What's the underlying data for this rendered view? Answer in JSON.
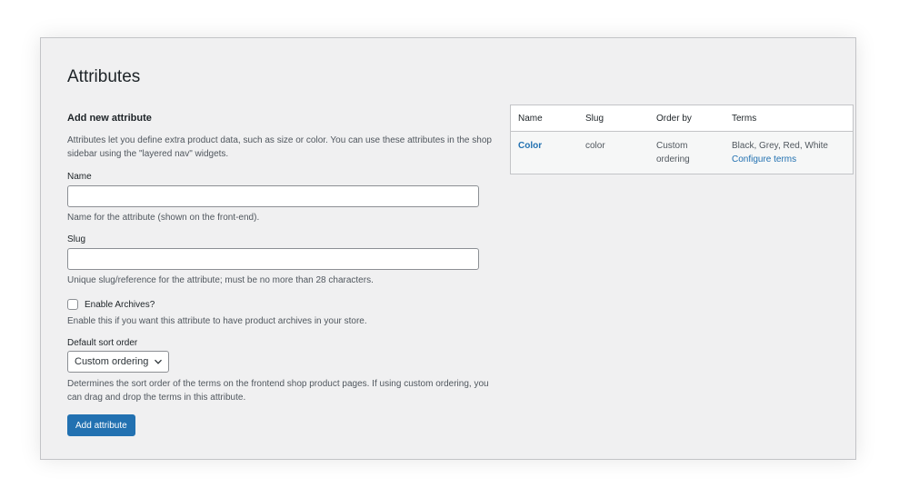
{
  "page": {
    "title": "Attributes"
  },
  "form": {
    "heading": "Add new attribute",
    "intro": "Attributes let you define extra product data, such as size or color. You can use these attributes in the shop sidebar using the \"layered nav\" widgets.",
    "name": {
      "label": "Name",
      "value": "",
      "help": "Name for the attribute (shown on the front-end)."
    },
    "slug": {
      "label": "Slug",
      "value": "",
      "help": "Unique slug/reference for the attribute; must be no more than 28 characters."
    },
    "archives": {
      "label": "Enable Archives?",
      "checked": false,
      "help": "Enable this if you want this attribute to have product archives in your store."
    },
    "sort": {
      "label": "Default sort order",
      "selected": "Custom ordering",
      "help": "Determines the sort order of the terms on the frontend shop product pages. If using custom ordering, you can drag and drop the terms in this attribute."
    },
    "submit_label": "Add attribute"
  },
  "table": {
    "columns": [
      "Name",
      "Slug",
      "Order by",
      "Terms"
    ],
    "rows": [
      {
        "name": "Color",
        "slug": "color",
        "order_by": "Custom ordering",
        "terms": "Black, Grey, Red, White",
        "configure_label": "Configure terms"
      }
    ]
  },
  "colors": {
    "accent": "#2271b1",
    "panel_bg": "#f0f0f1",
    "border": "#c3c4c7"
  },
  "icons": {
    "select_arrow": "chevron-down-icon"
  }
}
